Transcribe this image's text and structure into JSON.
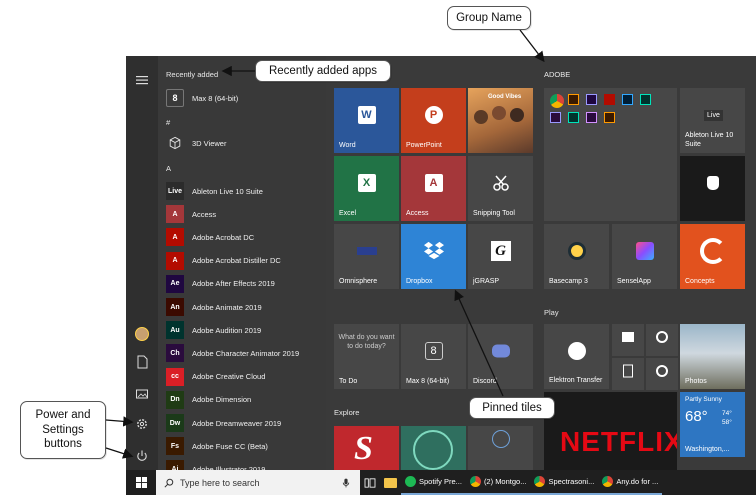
{
  "start_menu": {
    "recently_added_heading": "Recently added",
    "sections": {
      "hash": "#",
      "a": "A"
    },
    "recent_apps": [
      {
        "label": "Max 8 (64-bit)",
        "icon": "max-icon"
      }
    ],
    "hash_apps": [
      {
        "label": "3D Viewer",
        "icon": "cube-icon"
      }
    ],
    "a_apps": [
      {
        "label": "Ableton Live 10 Suite",
        "icon_text": "Live",
        "color": "#2b2b2b"
      },
      {
        "label": "Access",
        "icon_text": "A",
        "color": "#a4373a"
      },
      {
        "label": "Adobe Acrobat DC",
        "icon_text": "A",
        "color": "#b30b00"
      },
      {
        "label": "Adobe Acrobat Distiller DC",
        "icon_text": "A",
        "color": "#b30b00"
      },
      {
        "label": "Adobe After Effects 2019",
        "icon_text": "Ae",
        "color": "#1f0740"
      },
      {
        "label": "Adobe Animate 2019",
        "icon_text": "An",
        "color": "#3b0a00"
      },
      {
        "label": "Adobe Audition 2019",
        "icon_text": "Au",
        "color": "#00332e"
      },
      {
        "label": "Adobe Character Animator 2019",
        "icon_text": "Ch",
        "color": "#2a0b3d"
      },
      {
        "label": "Adobe Creative Cloud",
        "icon_text": "cc",
        "color": "#da1f26"
      },
      {
        "label": "Adobe Dimension",
        "icon_text": "Dn",
        "color": "#1f3b14"
      },
      {
        "label": "Adobe Dreamweaver 2019",
        "icon_text": "Dw",
        "color": "#1b3a19"
      },
      {
        "label": "Adobe Fuse CC (Beta)",
        "icon_text": "Fs",
        "color": "#3a1a00"
      },
      {
        "label": "Adobe Illustrator 2019",
        "icon_text": "Ai",
        "color": "#3a1a00"
      }
    ],
    "tiles": {
      "word": "Word",
      "powerpoint": "PowerPoint",
      "excel": "Excel",
      "access": "Access",
      "snipping": "Snipping Tool",
      "omnisphere": "Omnisphere",
      "dropbox": "Dropbox",
      "jgrasp": "jGRASP",
      "todo": "To Do",
      "todo_prompt": "What do you want to do today?",
      "max": "Max 8 (64-bit)",
      "discord": "Discord",
      "ableton": "Ableton Live 10 Suite",
      "ableton_badge": "Live",
      "basecamp": "Basecamp 3",
      "sensel": "SenselApp",
      "concepts": "Concepts",
      "elektron": "Elektron Transfer",
      "photos": "Photos",
      "weather_cond": "Partly Sunny",
      "weather_temp": "68°",
      "weather_hi": "74°",
      "weather_lo": "58°",
      "weather_city": "Washington,...",
      "netflix": "NETFLIX",
      "good_vibes": "Good Vibes"
    },
    "groups": {
      "adobe": "ADOBE",
      "play": "Play",
      "explore": "Explore"
    }
  },
  "taskbar": {
    "search_placeholder": "Type here to search",
    "items": [
      "Spotify Pre...",
      "(2) Montgo...",
      "Spectrasoni...",
      "Any.do for ..."
    ]
  },
  "callouts": {
    "group_name": "Group Name",
    "recently_added": "Recently added apps",
    "pinned_tiles": "Pinned tiles",
    "power_settings": "Power and Settings buttons"
  },
  "colors": {
    "word": "#2b579a",
    "powerpoint": "#c43e1c",
    "excel": "#217346",
    "access": "#a4373a",
    "dropbox": "#2e84d6",
    "concepts": "#e2521e",
    "netflix_bg": "#1a1a1a",
    "netflix": "#e50914",
    "weather": "#2e76c2"
  }
}
